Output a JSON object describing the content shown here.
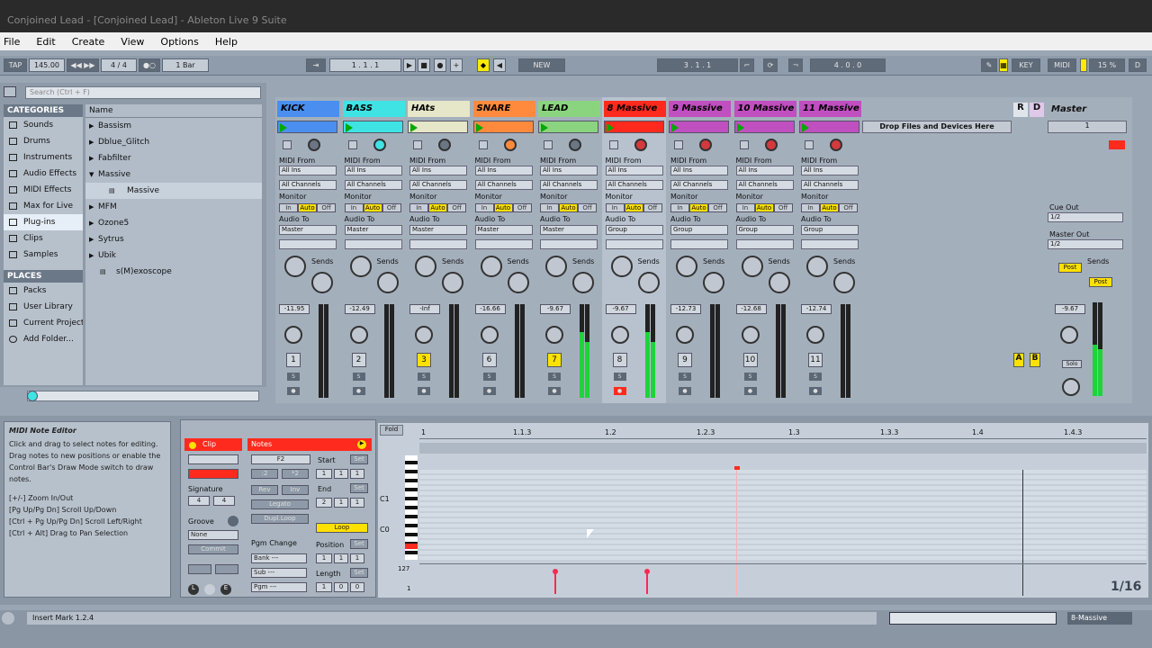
{
  "title": "Conjoined Lead - [Conjoined Lead] - Ableton Live 9 Suite",
  "menu": [
    "File",
    "Edit",
    "Create",
    "View",
    "Options",
    "Help"
  ],
  "control_bar": {
    "tap": "TAP",
    "tempo": "145.00",
    "signature": "4 / 4",
    "quantize": "1 Bar",
    "position": "1 . 1 . 1",
    "new": "NEW",
    "loop_start": "3 . 1 . 1",
    "loop_length": "4 . 0 . 0",
    "key": "KEY",
    "midi": "MIDI",
    "cpu": "15 %",
    "d": "D"
  },
  "browser": {
    "search_placeholder": "Search (Ctrl + F)",
    "categories_header": "CATEGORIES",
    "categories": [
      "Sounds",
      "Drums",
      "Instruments",
      "Audio Effects",
      "MIDI Effects",
      "Max for Live",
      "Plug-ins",
      "Clips",
      "Samples"
    ],
    "places_header": "PLACES",
    "places": [
      "Packs",
      "User Library",
      "Current Project",
      "Add Folder..."
    ],
    "name_header": "Name",
    "items": [
      {
        "label": "Bassism",
        "indent": 0
      },
      {
        "label": "Dblue_Glitch",
        "indent": 0
      },
      {
        "label": "Fabfilter",
        "indent": 0
      },
      {
        "label": "Massive",
        "indent": 0
      },
      {
        "label": "Massive",
        "indent": 1
      },
      {
        "label": "MFM",
        "indent": 0
      },
      {
        "label": "Ozone5",
        "indent": 0
      },
      {
        "label": "Sytrus",
        "indent": 0
      },
      {
        "label": "Ubik",
        "indent": 0
      },
      {
        "label": "s(M)exoscope",
        "indent": 1
      }
    ]
  },
  "mixer": {
    "tracks": [
      {
        "name": "KICK",
        "color": "#4a8ff0",
        "vol": "-11.95",
        "num": "1",
        "num_hl": false,
        "audio_to": "Master"
      },
      {
        "name": "BASS",
        "color": "#3fe3e3",
        "vol": "-12.49",
        "num": "2",
        "num_hl": false,
        "audio_to": "Master"
      },
      {
        "name": "HAts",
        "color": "#e6e6c8",
        "vol": "-Inf",
        "num": "3",
        "num_hl": true,
        "audio_to": "Master"
      },
      {
        "name": "SNARE",
        "color": "#ff8a3d",
        "vol": "-16.66",
        "num": "6",
        "num_hl": false,
        "audio_to": "Master"
      },
      {
        "name": "LEAD",
        "color": "#8bd47f",
        "vol": "-9.67",
        "num": "7",
        "num_hl": true,
        "audio_to": "Master"
      },
      {
        "name": "8 Massive",
        "color": "#ff2a1e",
        "vol": "-9.67",
        "num": "8",
        "num_hl": false,
        "audio_to": "Group"
      },
      {
        "name": "9 Massive",
        "color": "#c04fc0",
        "vol": "-12.73",
        "num": "9",
        "num_hl": false,
        "audio_to": "Group"
      },
      {
        "name": "10 Massive",
        "color": "#c04fc0",
        "vol": "-12.68",
        "num": "10",
        "num_hl": false,
        "audio_to": "Group"
      },
      {
        "name": "11 Massive",
        "color": "#c04fc0",
        "vol": "-12.74",
        "num": "11",
        "num_hl": false,
        "audio_to": "Group"
      }
    ],
    "drop_zone": "Drop Files and Devices Here",
    "return_r": "R",
    "return_d": "D",
    "master": {
      "name": "Master",
      "scene": "1",
      "cue_out_label": "Cue Out",
      "cue_out": "1/2",
      "master_out_label": "Master Out",
      "master_out": "1/2",
      "vol": "-9.67",
      "post1": "Post",
      "post2": "Post",
      "solo": "Solo",
      "a": "A",
      "b": "B"
    },
    "labels": {
      "midi_from": "MIDI From",
      "all_ins": "All Ins",
      "all_channels": "All Channels",
      "monitor": "Monitor",
      "in": "In",
      "auto": "Auto",
      "off": "Off",
      "audio_to": "Audio To",
      "sends": "Sends",
      "s": "S"
    }
  },
  "info": {
    "title": "MIDI Note Editor",
    "text": "Click and drag to select notes for editing. Drag notes to new positions or enable the Control Bar's Draw Mode switch to draw notes.",
    "shortcuts": [
      "[+/-] Zoom In/Out",
      "[Pg Up/Pg Dn] Scroll Up/Down",
      "[Ctrl + Pg Up/Pg Dn] Scroll Left/Right",
      "[Ctrl + Alt] Drag to Pan Selection"
    ]
  },
  "clip": {
    "clip_header": "Clip",
    "notes_header": "Notes",
    "signature_label": "Signature",
    "sig_num": "4",
    "sig_den": "4",
    "groove_label": "Groove",
    "groove": "None",
    "commit": "Commit",
    "note": "F2",
    "start_label": "Start",
    "set": "Set",
    "start": [
      "1",
      "1",
      "1"
    ],
    "end_label": "End",
    "end": [
      "2",
      "1",
      "1"
    ],
    "loop": "Loop",
    "position_label": "Position",
    "position": [
      "1",
      "1",
      "1"
    ],
    "length_label": "Length",
    "length": [
      "1",
      "0",
      "0"
    ],
    "pgm_change": "Pgm Change",
    "bank": "Bank ---",
    "sub": "Sub ---",
    "pgm": "Pgm ---",
    "legato": "Legato",
    "dupl_loop": "Dupl.Loop",
    "rev": "Rev",
    "inv": "Inv",
    "half": ":2",
    "double": "*2"
  },
  "editor": {
    "fold": "Fold",
    "ruler": [
      "1",
      "1.1.3",
      "1.2",
      "1.2.3",
      "1.3",
      "1.3.3",
      "1.4",
      "1.4.3"
    ],
    "c1": "C1",
    "c0": "C0",
    "vel_max": "127",
    "vel_min": "1",
    "grid": "1/16"
  },
  "status": {
    "text": "Insert Mark 1.2.4",
    "track": "8-Massive"
  }
}
